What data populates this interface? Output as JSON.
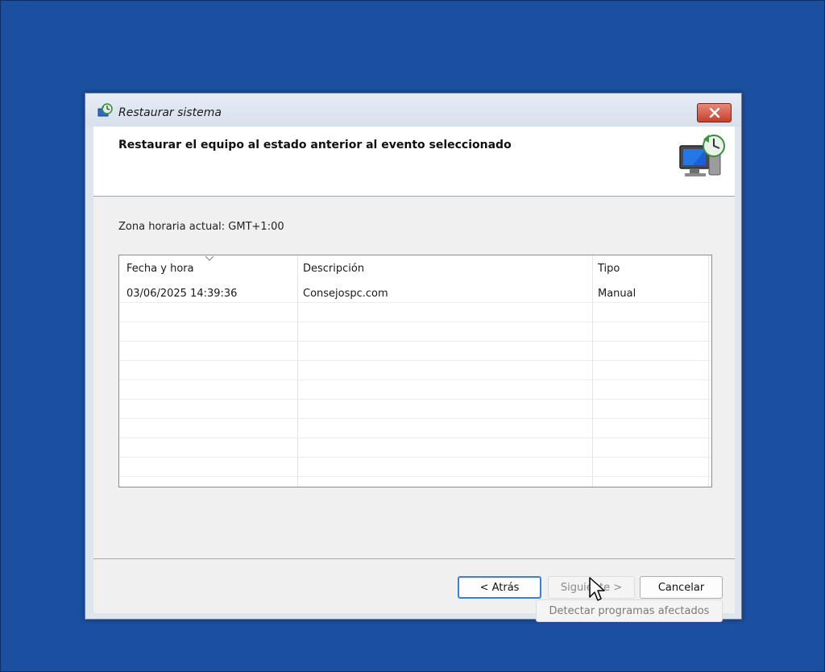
{
  "window": {
    "title": "Restaurar sistema",
    "close_label": "×"
  },
  "header": {
    "title": "Restaurar el equipo al estado anterior al evento seleccionado"
  },
  "timezone": {
    "label": "Zona horaria actual: GMT+1:00"
  },
  "table": {
    "columns": [
      "Fecha y hora",
      "Descripción",
      "Tipo"
    ],
    "sorted_column": "Fecha y hora",
    "rows": [
      {
        "date": "03/06/2025 14:39:36",
        "description": "Consejospc.com",
        "type": "Manual"
      }
    ]
  },
  "buttons": {
    "detect": "Detectar programas afectados",
    "back": "< Atrás",
    "next": "Siguiente >",
    "cancel": "Cancelar"
  },
  "icons": {
    "title": "system-restore-icon",
    "header": "computer-restore-icon",
    "close": "close-icon",
    "sort": "sort-arrow-icon",
    "cursor": "mouse-pointer-icon"
  },
  "colors": {
    "desktop": "#1b4fa0",
    "close_button": "#c8402c",
    "focus_border": "#3c7fd6"
  }
}
